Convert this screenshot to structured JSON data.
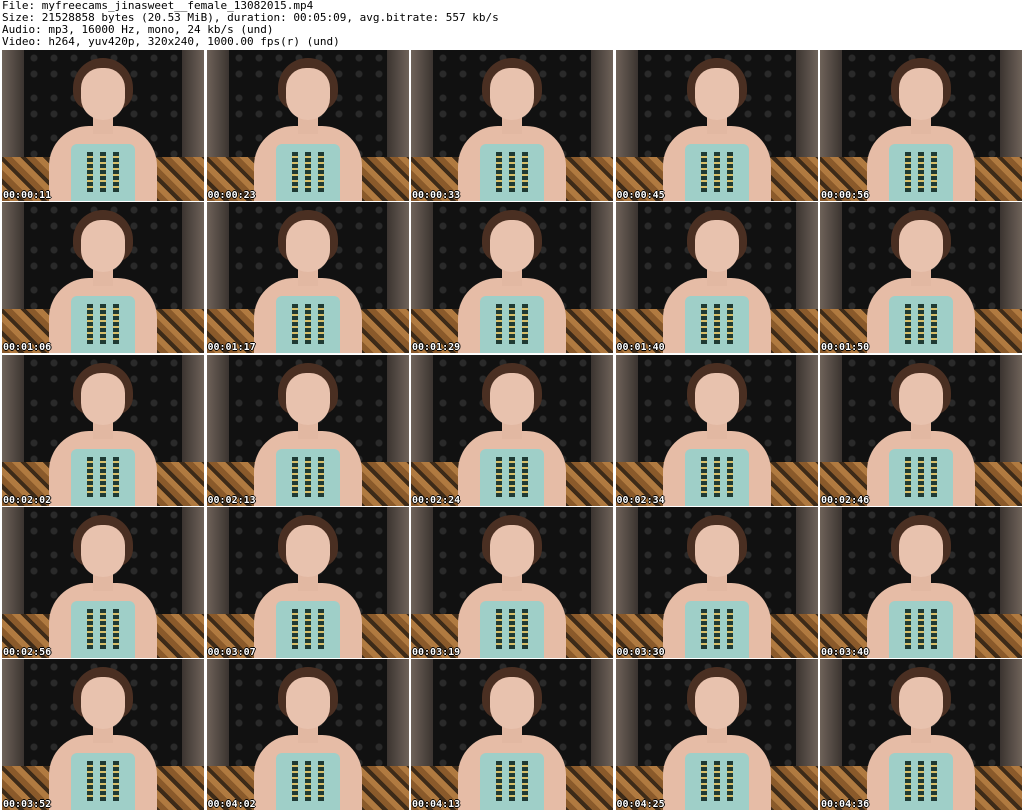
{
  "header": {
    "file": "File: myfreecams_jinasweet__female_13082015.mp4",
    "size": "Size: 21528858 bytes (20.53 MiB), duration: 00:05:09, avg.bitrate: 557 kb/s",
    "audio": "Audio: mp3, 16000 Hz, mono, 24 kb/s (und)",
    "video": "Video: h264, yuv420p, 320x240, 1000.00 fps(r) (und)"
  },
  "thumbnails": [
    {
      "time": "00:00:11"
    },
    {
      "time": "00:00:23"
    },
    {
      "time": "00:00:33"
    },
    {
      "time": "00:00:45"
    },
    {
      "time": "00:00:56"
    },
    {
      "time": "00:01:06"
    },
    {
      "time": "00:01:17"
    },
    {
      "time": "00:01:29"
    },
    {
      "time": "00:01:40"
    },
    {
      "time": "00:01:50"
    },
    {
      "time": "00:02:02"
    },
    {
      "time": "00:02:13"
    },
    {
      "time": "00:02:24"
    },
    {
      "time": "00:02:34"
    },
    {
      "time": "00:02:46"
    },
    {
      "time": "00:02:56"
    },
    {
      "time": "00:03:07"
    },
    {
      "time": "00:03:19"
    },
    {
      "time": "00:03:30"
    },
    {
      "time": "00:03:40"
    },
    {
      "time": "00:03:52"
    },
    {
      "time": "00:04:02"
    },
    {
      "time": "00:04:13"
    },
    {
      "time": "00:04:25"
    },
    {
      "time": "00:04:36"
    }
  ]
}
